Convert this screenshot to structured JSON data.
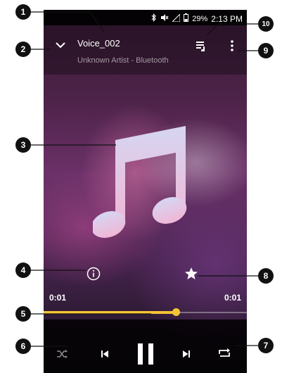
{
  "status_bar": {
    "battery": "29%",
    "time": "2:13 PM",
    "icons": [
      "bluetooth-icon",
      "mute-icon",
      "signal-icon",
      "battery-icon"
    ]
  },
  "header": {
    "title": "Voice_002",
    "subtitle": "Unknown Artist - Bluetooth",
    "icons": [
      "collapse-chevron-icon",
      "queue-icon",
      "overflow-menu-icon"
    ]
  },
  "album_art_icon": "music-note-icon",
  "actions": {
    "info_icon": "info-icon",
    "favorite_icon": "star-icon"
  },
  "progress": {
    "elapsed": "0:01",
    "total": "0:01",
    "fraction": 0.65
  },
  "controls": {
    "icons": [
      "shuffle-icon",
      "previous-icon",
      "pause-icon",
      "next-icon",
      "repeat-icon"
    ]
  },
  "callouts": [
    "1",
    "2",
    "3",
    "4",
    "5",
    "6",
    "7",
    "8",
    "9",
    "10"
  ],
  "colors": {
    "accent": "#f4c433",
    "callout": "#111111"
  }
}
